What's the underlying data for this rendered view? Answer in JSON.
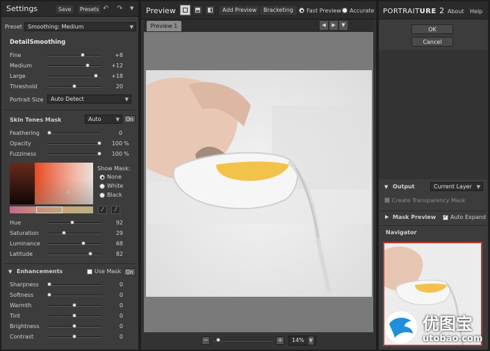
{
  "left": {
    "title": "Settings",
    "save": "Save",
    "presets": "Presets",
    "preset_label": "Preset",
    "preset_value": "Smoothing: Medium",
    "detail": {
      "title": "DetailSmoothing",
      "sliders": [
        {
          "label": "Fine",
          "value": "+8",
          "pos": 0.66
        },
        {
          "label": "Medium",
          "value": "+12",
          "pos": 0.77
        },
        {
          "label": "Large",
          "value": "+18",
          "pos": 0.93
        },
        {
          "label": "Threshold",
          "value": "20",
          "pos": 0.5
        }
      ],
      "portrait_size_label": "Portrait Size",
      "portrait_size_value": "Auto Detect"
    },
    "skin": {
      "title": "Skin Tones Mask",
      "mode": "Auto",
      "on": "On",
      "sliders": [
        {
          "label": "Feathering",
          "value": "0",
          "pct": "",
          "pos": 0.0
        },
        {
          "label": "Opacity",
          "value": "100",
          "pct": "%",
          "pos": 1.0
        },
        {
          "label": "Fuzziness",
          "value": "100",
          "pct": "%",
          "pos": 1.0
        }
      ],
      "show_mask_label": "Show Mask:",
      "mask_options": [
        "None",
        "White",
        "Black"
      ],
      "hsl": [
        {
          "label": "Hue",
          "value": "92",
          "pos": 0.46
        },
        {
          "label": "Saturation",
          "value": "29",
          "pos": 0.29
        },
        {
          "label": "Luminance",
          "value": "68",
          "pos": 0.68
        },
        {
          "label": "Latitude",
          "value": "82",
          "pos": 0.82
        }
      ]
    },
    "enh": {
      "title": "Enhancements",
      "use_mask": "Use Mask",
      "on": "On",
      "sliders": [
        {
          "label": "Sharpness",
          "value": "0",
          "pos": 0.0
        },
        {
          "label": "Softness",
          "value": "0",
          "pos": 0.0
        },
        {
          "label": "Warmth",
          "value": "0",
          "pos": 0.5
        },
        {
          "label": "Tint",
          "value": "0",
          "pos": 0.5
        },
        {
          "label": "Brightness",
          "value": "0",
          "pos": 0.5
        },
        {
          "label": "Contrast",
          "value": "0",
          "pos": 0.5
        }
      ]
    }
  },
  "center": {
    "title": "Preview",
    "add_preview": "Add Preview",
    "bracketing": "Bracketing",
    "fast_preview": "Fast Preview",
    "accurate": "Accurate",
    "tab": "Preview 1",
    "zoom": "14%",
    "zoom_pos": 0.05
  },
  "right": {
    "logo_a": "PORTRAIT",
    "logo_b": "URE",
    "logo_ver": "2",
    "about": "About",
    "help": "Help",
    "ok": "OK",
    "cancel": "Cancel",
    "output_title": "Output",
    "output_value": "Current Layer",
    "create_transparency": "Create Transparency Mask",
    "mask_preview": "Mask Preview",
    "auto_expand": "Auto Expand",
    "navigator": "Navigator"
  },
  "watermark": {
    "cn": "优图宝",
    "url": "utobao.com"
  },
  "colors": {
    "accent_red": "#c0392b",
    "panel": "#3c3c3c"
  }
}
